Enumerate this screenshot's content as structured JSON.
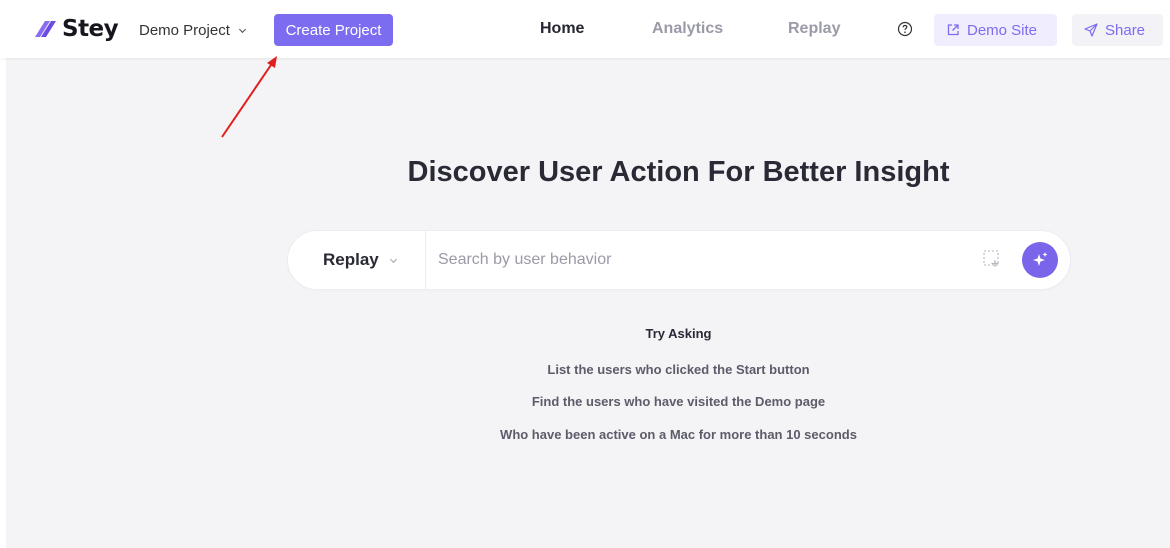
{
  "header": {
    "logo_text": "Stey",
    "project_select": {
      "value": "Demo Project"
    },
    "create_project_label": "Create Project",
    "nav": {
      "home": "Home",
      "analytics": "Analytics",
      "replay": "Replay"
    },
    "demo_site_label": "Demo Site",
    "share_label": "Share"
  },
  "main": {
    "headline": "Discover User Action For Better Insight",
    "search": {
      "mode": "Replay",
      "placeholder": "Search by user behavior"
    },
    "try_asking": {
      "title": "Try Asking",
      "suggestions": [
        "List the users who clicked the Start button",
        "Find the users who have visited the Demo page",
        "Who have been active on a Mac for more than 10 seconds"
      ]
    }
  },
  "icons": {
    "logo": "stey-logo-icon",
    "chevron": "chevron-down-icon",
    "help": "help-circle-icon",
    "demo_site": "external-link-icon",
    "share": "share-icon",
    "select_area": "select-area-icon",
    "ai": "sparkle-icon"
  },
  "colors": {
    "accent": "#7c6cf0",
    "accent_light": "#f0eefe",
    "background": "#f4f4f6",
    "annotation_arrow": "#e02020"
  }
}
